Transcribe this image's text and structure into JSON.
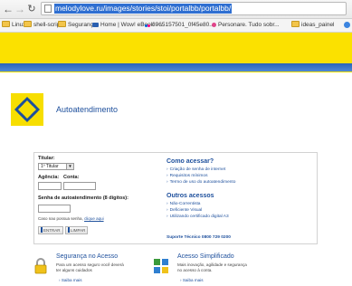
{
  "browser": {
    "url": "melodylove.ru/images/stories/stoi/portalbb/portalbb/",
    "bookmarks": [
      {
        "label": "Linux",
        "icon": "folder-icon"
      },
      {
        "label": "shell-script",
        "icon": "folder-icon"
      },
      {
        "label": "Segurança",
        "icon": "folder-icon"
      },
      {
        "label": "Home | Wow! eBook - ...",
        "icon": "page-icon"
      },
      {
        "label": "3965157501_0f45e80...",
        "icon": "flickr-icon"
      },
      {
        "label": "Personare. Tudo sobr...",
        "icon": "personare-icon"
      },
      {
        "label": "ideas_painel",
        "icon": "folder-icon"
      }
    ]
  },
  "site": {
    "heading": "Autoatendimento"
  },
  "login": {
    "titular_label": "Titular:",
    "titular_value": "1º Titular",
    "agencia_label": "Agência:",
    "conta_label": "Conta:",
    "senha_label": "Senha de autoatendimento (8 dígitos):",
    "forgot_text": "Caso nao possua senha,",
    "forgot_link": "clique aqui",
    "enter_label": "ENTRAR",
    "clear_label": "LIMPAR"
  },
  "help": {
    "access_title": "Como acessar?",
    "access_links": [
      "Criação de senha de internet",
      "Requisitos mínimos",
      "Termo de uso do autoatendimento"
    ],
    "other_title": "Outros acessos",
    "other_links": [
      "Não-Correntista",
      "Deficiente Visual",
      "Utilizando certificado digital A3"
    ],
    "support": "Suporte Técnico 0800 729 0200"
  },
  "promos": [
    {
      "title": "Segurança no Acesso",
      "desc_1": "Para um acesso seguro você deverá",
      "desc_2": "ter alguns cuidados",
      "link": "Saiba mais"
    },
    {
      "title": "Acesso Simplificado",
      "desc_1": "Mais inovação, agilidade e segurança",
      "desc_2": "no acesso à conta.",
      "link": "Saiba mais"
    }
  ],
  "colors": {
    "brand_yellow": "#fbe100",
    "brand_blue": "#1d4f9c"
  }
}
